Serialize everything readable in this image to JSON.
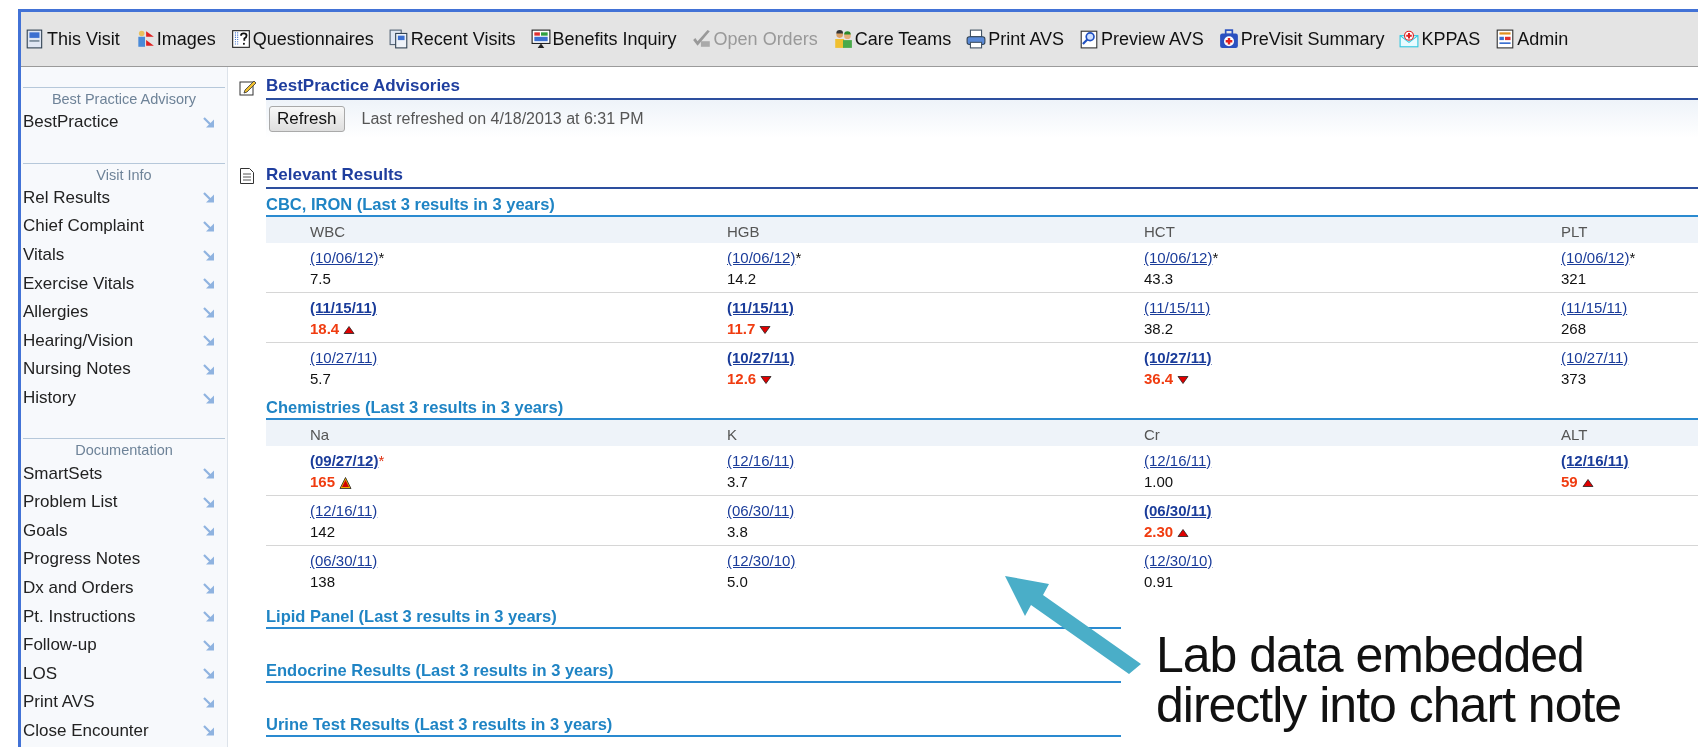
{
  "toolbar": [
    {
      "label": "This Visit",
      "disabled": false
    },
    {
      "label": "Images",
      "disabled": false
    },
    {
      "label": "Questionnaires",
      "disabled": false
    },
    {
      "label": "Recent Visits",
      "disabled": false
    },
    {
      "label": "Benefits Inquiry",
      "disabled": false
    },
    {
      "label": "Open Orders",
      "disabled": true
    },
    {
      "label": "Care Teams",
      "disabled": false
    },
    {
      "label": "Print AVS",
      "disabled": false
    },
    {
      "label": "Preview AVS",
      "disabled": false
    },
    {
      "label": "PreVisit Summary",
      "disabled": false
    },
    {
      "label": "KPPAS",
      "disabled": false
    },
    {
      "label": "Admin",
      "disabled": false
    }
  ],
  "sidebar": {
    "groups": [
      {
        "title": "Best Practice Advisory",
        "items": [
          "BestPractice"
        ]
      },
      {
        "title": "Visit Info",
        "items": [
          "Rel Results",
          "Chief Complaint",
          "Vitals",
          "Exercise Vitals",
          "Allergies",
          "Hearing/Vision",
          "Nursing Notes",
          "History"
        ]
      },
      {
        "title": "Documentation",
        "items": [
          "SmartSets",
          "Problem List",
          "Goals",
          "Progress Notes",
          "Dx and Orders",
          "Pt. Instructions",
          "Follow-up",
          "LOS",
          "Print AVS",
          "Close Encounter"
        ]
      }
    ]
  },
  "advisories": {
    "title": "BestPractice Advisories",
    "refresh_button": "Refresh",
    "last_refreshed": "Last refreshed on 4/18/2013 at 6:31 PM"
  },
  "results": {
    "title": "Relevant Results",
    "panels": [
      {
        "title": "CBC, IRON (Last 3 results in 3 years)",
        "columns": [
          {
            "name": "WBC",
            "results": [
              {
                "date": "(10/06/12)",
                "note": "*",
                "value": "7.5",
                "abnormal": false
              },
              {
                "date": "(11/15/11)",
                "value": "18.4",
                "abnormal": true,
                "high": true,
                "critical": false
              },
              {
                "date": "(10/27/11)",
                "value": "5.7",
                "abnormal": false
              }
            ]
          },
          {
            "name": "HGB",
            "results": [
              {
                "date": "(10/06/12)",
                "note": "*",
                "value": "14.2",
                "abnormal": false
              },
              {
                "date": "(11/15/11)",
                "value": "11.7",
                "abnormal": true,
                "high": false,
                "critical": false
              },
              {
                "date": "(10/27/11)",
                "value": "12.6",
                "abnormal": true,
                "high": false,
                "critical": false
              }
            ]
          },
          {
            "name": "HCT",
            "results": [
              {
                "date": "(10/06/12)",
                "note": "*",
                "value": "43.3",
                "abnormal": false
              },
              {
                "date": "(11/15/11)",
                "value": "38.2",
                "abnormal": false
              },
              {
                "date": "(10/27/11)",
                "value": "36.4",
                "abnormal": true,
                "high": false,
                "critical": false
              }
            ]
          },
          {
            "name": "PLT",
            "results": [
              {
                "date": "(10/06/12)",
                "note": "*",
                "value": "321",
                "abnormal": false
              },
              {
                "date": "(11/15/11)",
                "value": "268",
                "abnormal": false
              },
              {
                "date": "(10/27/11)",
                "value": "373",
                "abnormal": false
              }
            ]
          }
        ]
      },
      {
        "title": "Chemistries (Last 3 results in 3 years)",
        "columns": [
          {
            "name": "Na",
            "results": [
              {
                "date": "(09/27/12)",
                "note": "*",
                "value": "165",
                "abnormal": true,
                "high": true,
                "critical": true
              },
              {
                "date": "(12/16/11)",
                "value": "142",
                "abnormal": false
              },
              {
                "date": "(06/30/11)",
                "value": "138",
                "abnormal": false
              }
            ]
          },
          {
            "name": "K",
            "results": [
              {
                "date": "(12/16/11)",
                "value": "3.7",
                "abnormal": false
              },
              {
                "date": "(06/30/11)",
                "value": "3.8",
                "abnormal": false
              },
              {
                "date": "(12/30/10)",
                "value": "5.0",
                "abnormal": false
              }
            ]
          },
          {
            "name": "Cr",
            "results": [
              {
                "date": "(12/16/11)",
                "value": "1.00",
                "abnormal": false
              },
              {
                "date": "(06/30/11)",
                "value": "2.30",
                "abnormal": true,
                "high": true,
                "critical": false
              },
              {
                "date": "(12/30/10)",
                "value": "0.91",
                "abnormal": false
              }
            ]
          },
          {
            "name": "ALT",
            "results": [
              {
                "date": "(12/16/11)",
                "value": "59",
                "abnormal": true,
                "high": true,
                "critical": false
              }
            ]
          }
        ]
      },
      {
        "title": "Lipid Panel (Last 3 results in 3 years)"
      },
      {
        "title": "Endocrine Results (Last 3 results in 3 years)"
      },
      {
        "title": "Urine Test Results (Last 3 results in 3 years)"
      }
    ]
  },
  "annotation": {
    "text": "Lab data embedded directly into chart note"
  }
}
